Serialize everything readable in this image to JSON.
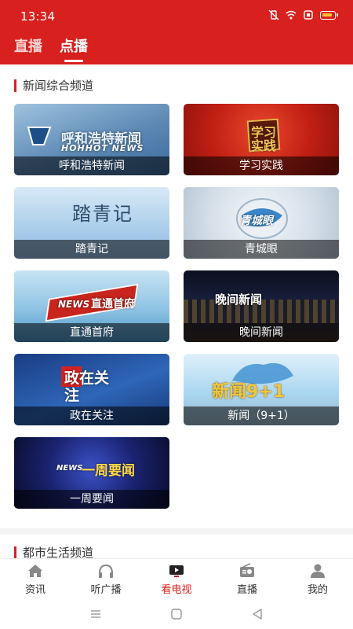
{
  "status_bar": {
    "time": "13:34"
  },
  "top_tabs": [
    {
      "label": "直播",
      "active": false
    },
    {
      "label": "点播",
      "active": true
    }
  ],
  "sections": [
    {
      "title": "新闻综合频道",
      "programs": [
        {
          "name": "呼和浩特新闻",
          "thumb_text": "呼和浩特新闻",
          "thumb_sub": "HOHHOT NEWS"
        },
        {
          "name": "学习实践",
          "thumb_text": "学习实践"
        },
        {
          "name": "踏青记",
          "thumb_text": "踏青记"
        },
        {
          "name": "青城眼",
          "thumb_text": "青城眼"
        },
        {
          "name": "直通首府",
          "thumb_text": "直通首府",
          "thumb_sub": "NEWS"
        },
        {
          "name": "晚间新闻",
          "thumb_text": "晚间新闻"
        },
        {
          "name": "政在关注",
          "thumb_text": "政在关注"
        },
        {
          "name": "新闻（9+1）",
          "thumb_text": "新闻9+1"
        },
        {
          "name": "一周要闻",
          "thumb_text": "一周要闻",
          "thumb_sub": "NEWS"
        }
      ]
    },
    {
      "title": "都市生活频道"
    }
  ],
  "bottom_nav": [
    {
      "label": "资讯",
      "icon": "home-icon",
      "active": false
    },
    {
      "label": "听广播",
      "icon": "headphones-icon",
      "active": false
    },
    {
      "label": "看电视",
      "icon": "tv-icon",
      "active": true
    },
    {
      "label": "直播",
      "icon": "radio-icon",
      "active": false
    },
    {
      "label": "我的",
      "icon": "user-icon",
      "active": false
    }
  ],
  "colors": {
    "brand_red": "#d8211f",
    "accent_yellow": "#f5c132"
  }
}
